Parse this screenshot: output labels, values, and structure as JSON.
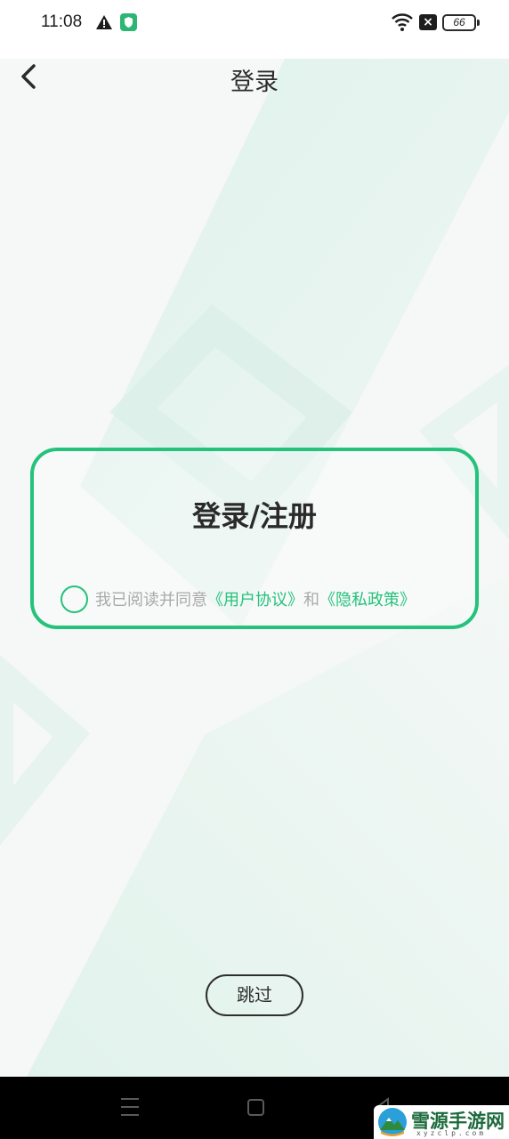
{
  "status_bar": {
    "time": "11:08",
    "battery": "66",
    "icons": [
      "alert-icon",
      "shield-app-icon",
      "wifi-icon",
      "no-sim-icon",
      "battery-icon"
    ]
  },
  "header": {
    "back_icon": "chevron-left-icon",
    "title": "登录"
  },
  "login_card": {
    "title": "登录/注册",
    "agreement": {
      "prefix": "我已阅读并同意",
      "user_agreement_link": "《用户协议》",
      "conjunction": "和",
      "privacy_policy_link": "《隐私政策》"
    }
  },
  "skip_button": {
    "label": "跳过"
  },
  "nav_bar": {
    "icons": [
      "menu-icon",
      "home-icon",
      "back-triangle-icon"
    ]
  },
  "watermark": {
    "text": "雪源手游网",
    "subtext": "xyzclp.com"
  },
  "colors": {
    "accent": "#24c27b",
    "background": "#f6f7f7",
    "text": "#2a2a2a",
    "muted": "#a9a9a9"
  }
}
